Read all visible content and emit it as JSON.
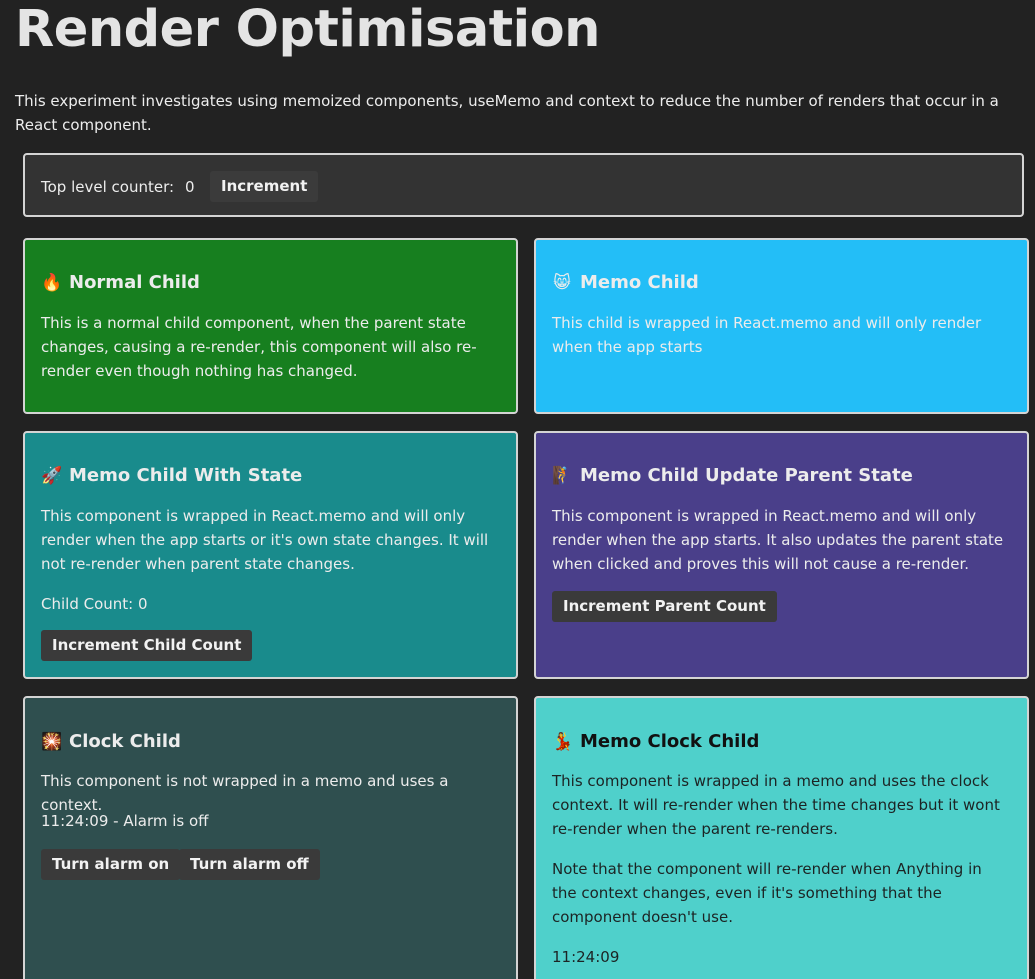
{
  "page": {
    "title": "Render Optimisation",
    "intro": "This experiment investigates using memoized components, useMemo and context to reduce the number of renders that occur in a React component."
  },
  "top_counter": {
    "label": "Top level counter:",
    "value": "0",
    "button_label": "Increment"
  },
  "cards": {
    "normal_child": {
      "icon": "fire-icon",
      "emoji": "🔥",
      "title": "Normal Child",
      "text": "This is a normal child component, when the parent state changes, causing a re-render, this component will also re-render even though nothing has changed.",
      "color": "#177f1f"
    },
    "memo_child": {
      "icon": "cat-icon",
      "emoji": "😸",
      "title": "Memo Child",
      "text": "This child is wrapped in React.memo and will only render when the app starts",
      "color": "#23bef7"
    },
    "memo_child_state": {
      "icon": "rocket-icon",
      "emoji": "🚀",
      "title": "Memo Child With State",
      "text": "This component is wrapped in React.memo and will only render when the app starts or it's own state changes. It will not re-render when parent state changes.",
      "count_text": "Child Count: 0",
      "button_label": "Increment Child Count",
      "color": "#198b8c"
    },
    "memo_child_parent": {
      "icon": "climber-icon",
      "emoji": "🧗",
      "title": "Memo Child Update Parent State",
      "text": "This component is wrapped in React.memo and will only render when the app starts. It also updates the parent state when clicked and proves this will not cause a re-render.",
      "button_label": "Increment Parent Count",
      "color": "#4a3f8a"
    },
    "clock_child": {
      "icon": "sparkles-icon",
      "emoji": "🎇",
      "title": "Clock Child",
      "text": "This component is not wrapped in a memo and uses a context.",
      "status_text": "11:24:09 - Alarm is off",
      "alarm_on_label": "Turn alarm on",
      "alarm_off_label": "Turn alarm off",
      "color": "#2f4f4f"
    },
    "memo_clock_child": {
      "icon": "dancer-icon",
      "emoji": "💃",
      "title": "Memo Clock Child",
      "text": "This component is wrapped in a memo and uses the clock context. It will re-render when the time changes but it wont re-render when the parent re-renders.",
      "note": "Note that the component will re-render when Anything in the context changes, even if it's something that the component doesn't use.",
      "time_text": "11:24:09",
      "color": "#4fd0cb"
    }
  }
}
